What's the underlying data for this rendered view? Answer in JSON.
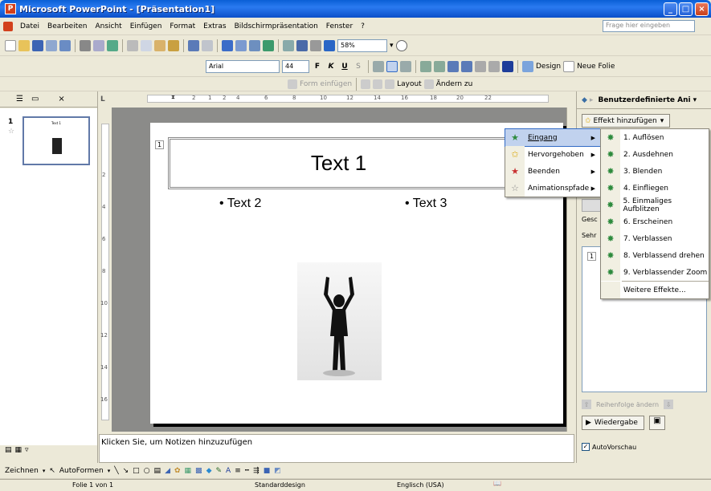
{
  "window": {
    "title": "Microsoft PowerPoint - [Präsentation1]",
    "app_icon": "P"
  },
  "menu": {
    "items": [
      "Datei",
      "Bearbeiten",
      "Ansicht",
      "Einfügen",
      "Format",
      "Extras",
      "Bildschirmpräsentation",
      "Fenster",
      "?"
    ],
    "help_placeholder": "Frage hier eingeben"
  },
  "toolbar": {
    "zoom": "58%"
  },
  "format_toolbar": {
    "font": "Arial",
    "size": "44",
    "bold": "F",
    "italic": "K",
    "underline": "U",
    "shadow": "S",
    "design": "Design",
    "new_slide": "Neue Folie"
  },
  "layout_toolbar": {
    "insert_form": "Form einfügen",
    "layout": "Layout",
    "change_to": "Ändern zu"
  },
  "outline": {
    "slide_number": "1",
    "thumb_title": "Text 1"
  },
  "ruler": {
    "h_labels": [
      "2",
      "1",
      "2",
      "4",
      "6",
      "8",
      "10",
      "12",
      "14",
      "16",
      "18",
      "20",
      "22"
    ],
    "v_labels": [
      "2",
      "4",
      "6",
      "8",
      "10",
      "12",
      "14",
      "16"
    ]
  },
  "slide": {
    "number": "1",
    "title": "Text 1",
    "bullet_left": "Text 2",
    "bullet_right": "Text 3"
  },
  "notes": {
    "placeholder": "Klicken Sie, um Notizen hinzuzufügen"
  },
  "taskpane": {
    "title": "Benutzerdefinierte Ani",
    "add_effect": "Effekt hinzufügen",
    "list_item": "1",
    "speed_left": "Gesc",
    "speed_right": "Sehr",
    "reorder": "Reihenfolge ändern",
    "play": "Wiedergabe",
    "autopreview": "AutoVorschau"
  },
  "effect_menu": {
    "items": [
      "Eingang",
      "Hervorgehoben",
      "Beenden",
      "Animationspfade"
    ]
  },
  "entrance_menu": {
    "items": [
      "1. Auflösen",
      "2. Ausdehnen",
      "3. Blenden",
      "4. Einfliegen",
      "5. Einmaliges Aufblitzen",
      "6. Erscheinen",
      "7. Verblassen",
      "8. Verblassend drehen",
      "9. Verblassender Zoom"
    ],
    "more": "Weitere Effekte..."
  },
  "drawing": {
    "draw": "Zeichnen",
    "autoshapes": "AutoFormen"
  },
  "status": {
    "slide": "Folie 1 von 1",
    "design": "Standarddesign",
    "language": "Englisch (USA)"
  }
}
